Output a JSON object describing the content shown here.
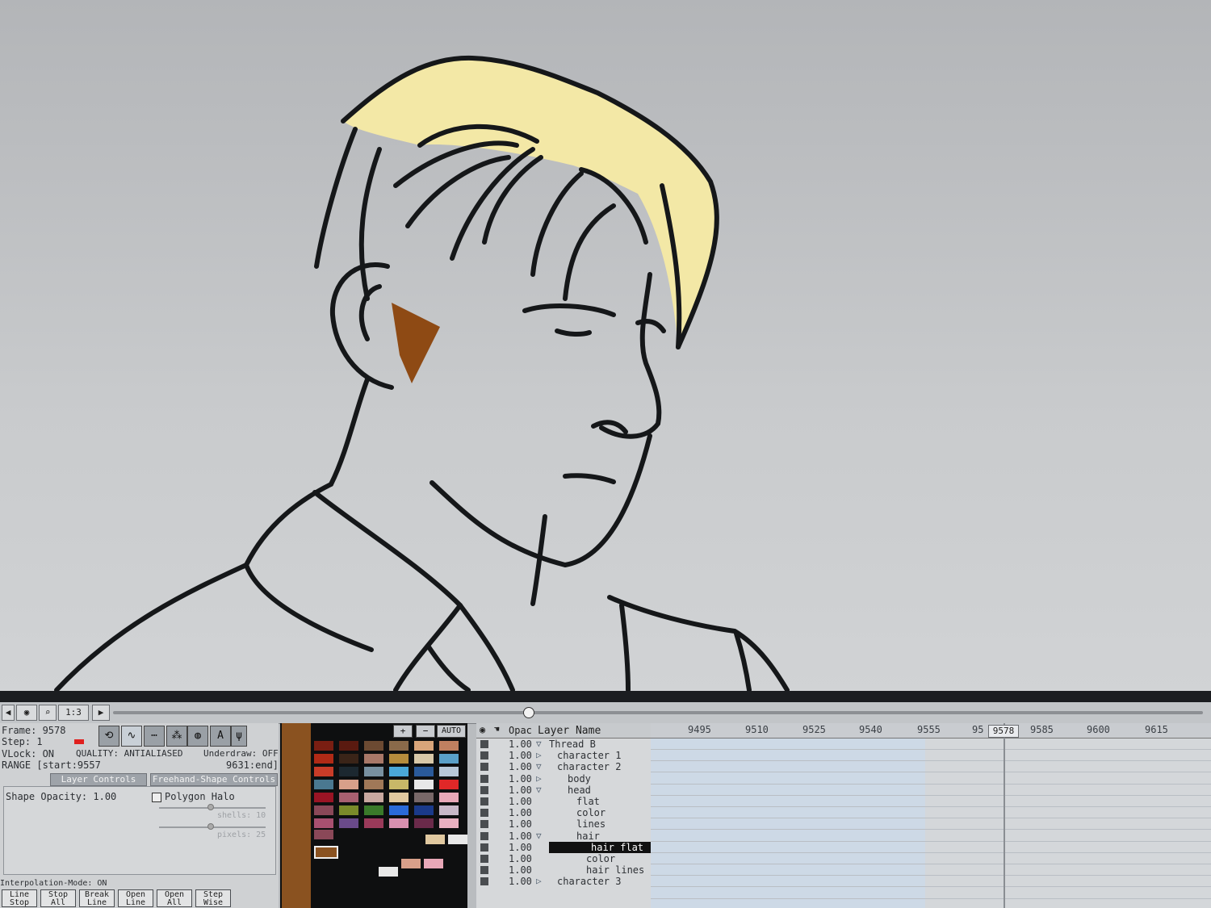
{
  "toolbar": {
    "zoom": "1:3"
  },
  "info": {
    "frame": "Frame: 9578",
    "step": "Step: 1",
    "vlock": "VLock: ON",
    "quality": "QUALITY: ANTIALIASED",
    "underdraw": "Underdraw: OFF",
    "range_start": "RANGE [start:9557",
    "range_end": "9631:end]"
  },
  "tabs": [
    "Layer Controls",
    "Freehand-Shape Controls"
  ],
  "layer_controls": {
    "shape_opacity": "Shape Opacity: 1.00",
    "polygon_halo": "Polygon Halo",
    "shells": "shells: 10",
    "pixels": "pixels: 25"
  },
  "interpolation_mode": "Interpolation-Mode: ON",
  "bottom_buttons": [
    {
      "line1": "Line",
      "line2": "Stop"
    },
    {
      "line1": "Stop",
      "line2": "All"
    },
    {
      "line1": "Break",
      "line2": "Line"
    },
    {
      "line1": "Open",
      "line2": "Line"
    },
    {
      "line1": "Open",
      "line2": "All"
    },
    {
      "line1": "Step",
      "line2": "Wise"
    }
  ],
  "palette": {
    "plus": "+",
    "minus": "−",
    "auto": "AUTO",
    "active_color": "#8a5220"
  },
  "layers": {
    "header_opac": "Opac",
    "header_name": "Layer Name",
    "rows": [
      {
        "opac": "1.00",
        "name": "Thread B",
        "expanded": true
      },
      {
        "opac": "1.00",
        "name": "character 1",
        "expanded": false
      },
      {
        "opac": "1.00",
        "name": "character 2",
        "expanded": true
      },
      {
        "opac": "1.00",
        "name": "body",
        "expanded": false
      },
      {
        "opac": "1.00",
        "name": "head",
        "expanded": true
      },
      {
        "opac": "1.00",
        "name": "flat"
      },
      {
        "opac": "1.00",
        "name": "color"
      },
      {
        "opac": "1.00",
        "name": "lines"
      },
      {
        "opac": "1.00",
        "name": "hair",
        "expanded": true
      },
      {
        "opac": "1.00",
        "name": "hair flat",
        "selected": true
      },
      {
        "opac": "1.00",
        "name": "color"
      },
      {
        "opac": "1.00",
        "name": "hair lines"
      },
      {
        "opac": "1.00",
        "name": "character 3",
        "expanded": false
      }
    ]
  },
  "timeline": {
    "ticks": [
      "9495",
      "9510",
      "9525",
      "9540",
      "9555",
      "95",
      "9585",
      "9600",
      "9615"
    ],
    "current_frame": "9578"
  },
  "colors": {
    "hair": "#f3e8a6",
    "ear_shadow": "#8e4a14",
    "canvas": "#c4c6c9",
    "selection": "#111111"
  }
}
